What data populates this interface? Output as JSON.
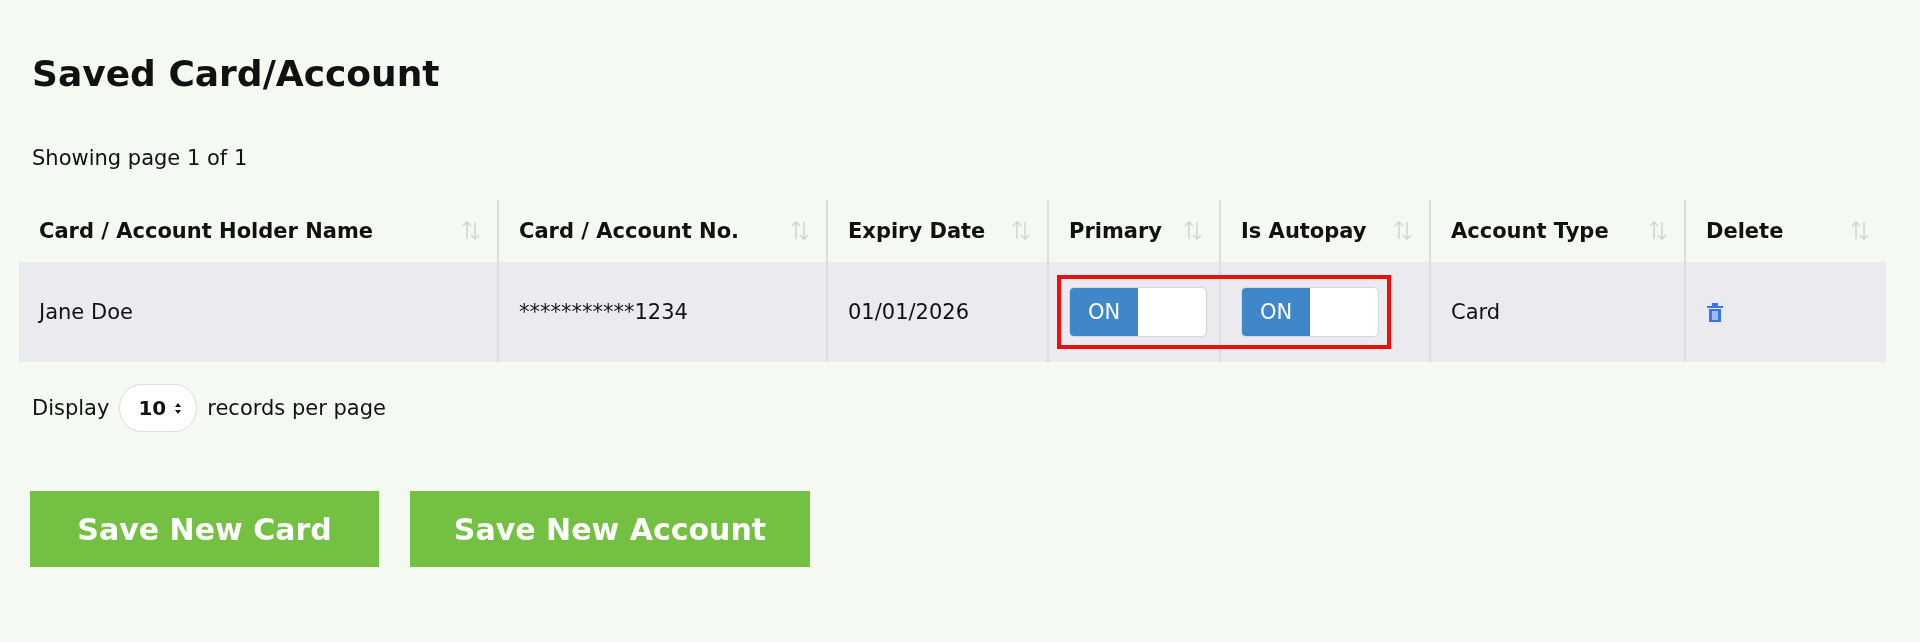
{
  "title": "Saved Card/Account",
  "paging_info": "Showing page 1 of 1",
  "table": {
    "columns": [
      {
        "label": "Card / Account Holder Name"
      },
      {
        "label": "Card / Account No."
      },
      {
        "label": "Expiry Date"
      },
      {
        "label": "Primary"
      },
      {
        "label": "Is Autopay"
      },
      {
        "label": "Account Type"
      },
      {
        "label": "Delete"
      }
    ],
    "rows": [
      {
        "cells": [
          {
            "kind": "text",
            "text": "Jane Doe"
          },
          {
            "kind": "text",
            "text": "***********1234"
          },
          {
            "kind": "text",
            "text": "01/01/2026"
          },
          {
            "kind": "toggle",
            "label": "ON",
            "on": true,
            "highlighted": true
          },
          {
            "kind": "toggle",
            "label": "ON",
            "on": true,
            "highlighted": true
          },
          {
            "kind": "text",
            "text": "Card"
          },
          {
            "kind": "delete"
          }
        ]
      }
    ]
  },
  "page_size": {
    "before": "Display",
    "value": "10",
    "after": "records per page"
  },
  "buttons": [
    "Save New Card",
    "Save New Account"
  ]
}
